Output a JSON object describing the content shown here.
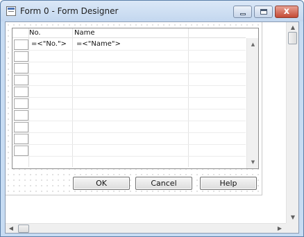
{
  "window": {
    "title": "Form 0 - Form Designer",
    "close_glyph": "x",
    "icons": {
      "app": "form-designer-app-icon",
      "minimize": "minimize-icon",
      "maximize": "maximize-icon",
      "close": "close-icon"
    }
  },
  "table": {
    "columns": [
      "No.",
      "Name"
    ],
    "first_row": {
      "no": "=<\"No.\">",
      "name": "=<\"Name\">"
    },
    "empty_row_count": 9,
    "scroll_up_glyph": "▲",
    "scroll_down_glyph": "▼"
  },
  "buttons": {
    "ok": "OK",
    "cancel": "Cancel",
    "help": "Help"
  },
  "scrollbars": {
    "up": "▲",
    "down": "▼",
    "left": "◀",
    "right": "▶"
  }
}
